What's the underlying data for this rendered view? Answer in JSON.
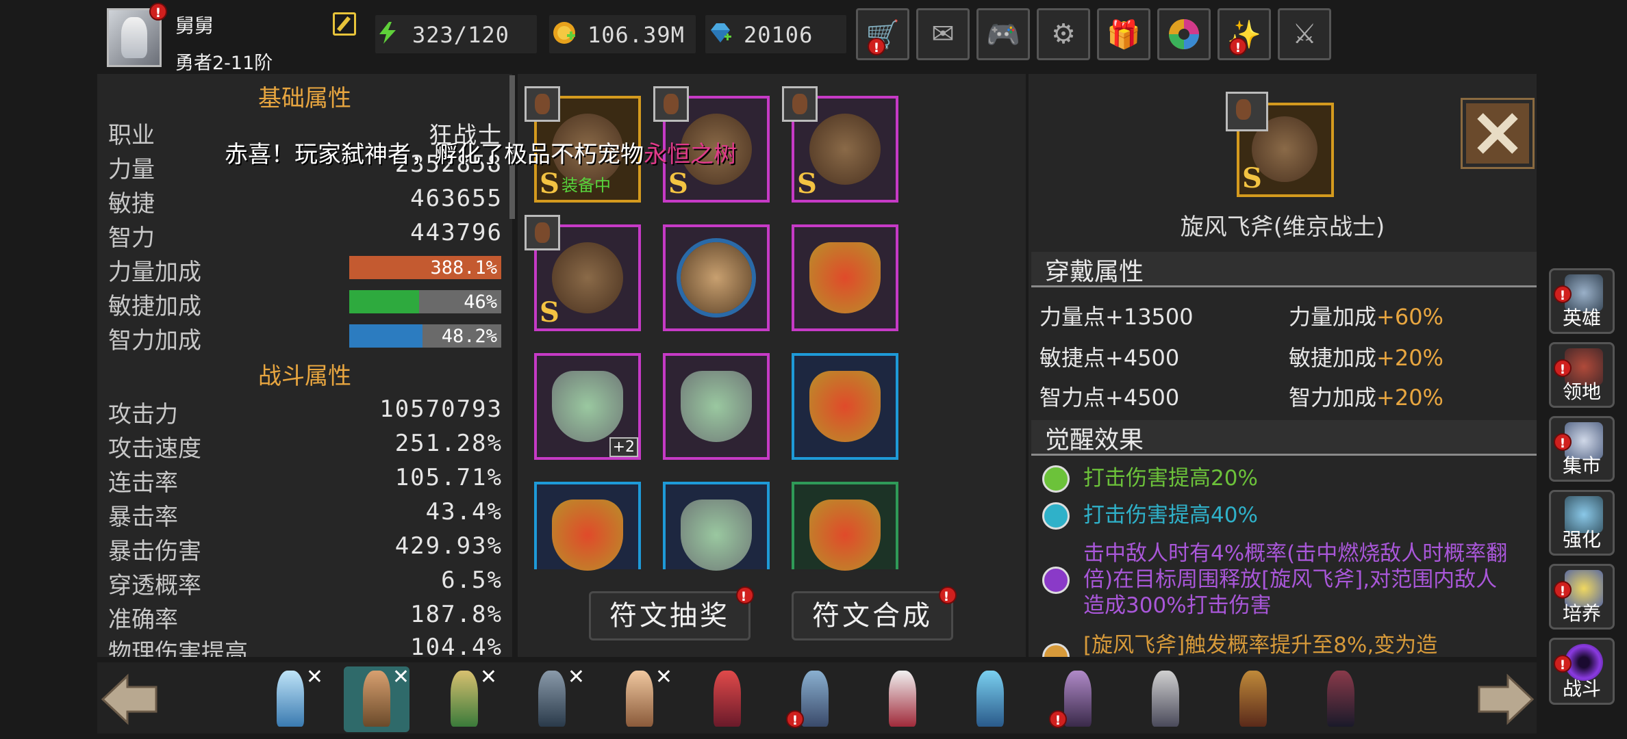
{
  "player": {
    "name": "舅舅",
    "rank": "勇者2-11阶"
  },
  "resources": {
    "stamina": "323/120",
    "gold": "106.39M",
    "gems": "20106"
  },
  "top_buttons": [
    "shop-cart-icon",
    "mail-icon",
    "gamepad-icon",
    "gear-icon",
    "gift-icon",
    "color-wheel-icon",
    "fireworks-icon",
    "crossed-swords-icon"
  ],
  "toast": {
    "prefix": "赤喜！玩家弑神者，孵化了极品不朽宠物",
    "highlight": "永恒之树"
  },
  "basic_attrs": {
    "title": "基础属性",
    "class_label": "职业",
    "class_value": "狂战士",
    "rows": [
      {
        "label": "力量",
        "value": "2352858"
      },
      {
        "label": "敏捷",
        "value": "463655"
      },
      {
        "label": "智力",
        "value": "443796"
      }
    ],
    "bonuses": [
      {
        "label": "力量加成",
        "value": "388.1%",
        "fill": 1.0,
        "color": "#c45a30"
      },
      {
        "label": "敏捷加成",
        "value": "46%",
        "fill": 0.46,
        "color": "#2eaa3e"
      },
      {
        "label": "智力加成",
        "value": "48.2%",
        "fill": 0.482,
        "color": "#2c7cc0"
      }
    ]
  },
  "combat_attrs": {
    "title": "战斗属性",
    "rows": [
      {
        "label": "攻击力",
        "value": "10570793"
      },
      {
        "label": "攻击速度",
        "value": "251.28%"
      },
      {
        "label": "连击率",
        "value": "105.71%"
      },
      {
        "label": "暴击率",
        "value": "43.4%"
      },
      {
        "label": "暴击伤害",
        "value": "429.93%"
      },
      {
        "label": "穿透概率",
        "value": "6.5%"
      },
      {
        "label": "准确率",
        "value": "187.8%"
      },
      {
        "label": "物理伤害提高",
        "value": "104.4%"
      }
    ]
  },
  "inventory": {
    "equipped_label": "装备中",
    "tier_label": "S",
    "plus_label": "+2",
    "buttons": {
      "draw": "符文抽奖",
      "merge": "符文合成"
    }
  },
  "item_detail": {
    "name": "旋风飞斧(维京战士)",
    "tier": "S",
    "wear_title": "穿戴属性",
    "wear_attrs": [
      {
        "label": "力量点",
        "value": "+13500"
      },
      {
        "label": "力量加成",
        "value": "+60%"
      },
      {
        "label": "敏捷点",
        "value": "+4500"
      },
      {
        "label": "敏捷加成",
        "value": "+20%"
      },
      {
        "label": "智力点",
        "value": "+4500"
      },
      {
        "label": "智力加成",
        "value": "+20%"
      }
    ],
    "awaken_title": "觉醒效果",
    "effects": [
      {
        "text": "打击伤害提高20%",
        "color": "#6cc23a"
      },
      {
        "text": "打击伤害提高40%",
        "color": "#2fb1c9"
      },
      {
        "text": "击中敌人时有4%概率(击中燃烧敌人时概率翻倍)在目标周围释放[旋风飞斧],对范围内敌人造成300%打击伤害",
        "color": "#a957d9"
      },
      {
        "text": "[旋风飞斧]触发概率提升至8%,变为造",
        "color": "#d79a3a"
      }
    ]
  },
  "side_menu": [
    {
      "label": "英雄"
    },
    {
      "label": "领地"
    },
    {
      "label": "集市"
    },
    {
      "label": "强化"
    },
    {
      "label": "培养"
    },
    {
      "label": "战斗"
    }
  ],
  "colors": {
    "gold": "#e8a640",
    "panel": "#262626",
    "badge": "#d0201e"
  }
}
